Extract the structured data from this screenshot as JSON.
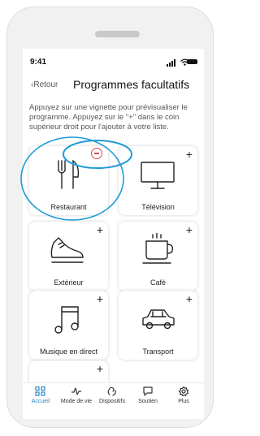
{
  "status_bar": {
    "time": "9:41",
    "icons": [
      "signal-icon",
      "wifi-icon",
      "battery-icon"
    ]
  },
  "header": {
    "back_label": "Retour",
    "title": "Programmes facultatifs"
  },
  "instructions": "Appuyez sur une vignette pour prévisualiser le programme. Appuyez sur le \"+\" dans le coin supérieur droit pour l'ajouter à votre liste.",
  "programs": [
    {
      "label": "Restaurant",
      "icon": "fork-knife-icon",
      "action": "remove"
    },
    {
      "label": "Télévision",
      "icon": "tv-icon",
      "action": "+"
    },
    {
      "label": "Extérieur",
      "icon": "sneaker-icon",
      "action": "+"
    },
    {
      "label": "Café",
      "icon": "coffee-cup-icon",
      "action": "+"
    },
    {
      "label": "Musique en direct",
      "icon": "music-note-icon",
      "action": "+"
    },
    {
      "label": "Transport",
      "icon": "car-icon",
      "action": "+"
    },
    {
      "label": "",
      "icon": "",
      "action": "+"
    }
  ],
  "tabbar": {
    "active": "Accueil",
    "items": [
      {
        "label": "Accueil",
        "icon": "grid-icon"
      },
      {
        "label": "Mode de vie",
        "icon": "activity-icon"
      },
      {
        "label": "Dispositifs",
        "icon": "hearing-aids-icon"
      },
      {
        "label": "Soutien",
        "icon": "chat-bubble-icon"
      },
      {
        "label": "Plus",
        "icon": "gear-icon"
      }
    ]
  },
  "colors": {
    "accent": "#2b87c9",
    "remove": "#e0494c",
    "highlight": "#1e9bd7",
    "frame": "#f1f1f1"
  }
}
